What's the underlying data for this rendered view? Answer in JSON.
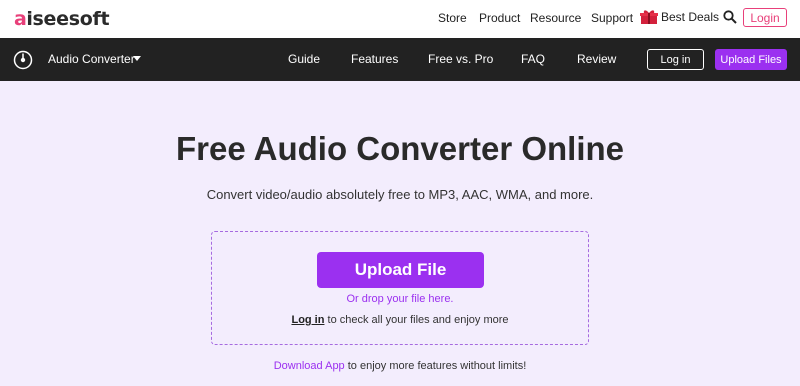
{
  "brand": {
    "logo_mark": "a",
    "logo_text": "iseesoft"
  },
  "top_nav": {
    "items": [
      "Store",
      "Product",
      "Resource",
      "Support"
    ],
    "deals_label": "Best Deals",
    "login_label": "Login"
  },
  "navbar": {
    "app_title": "Audio Converter",
    "links": [
      "Guide",
      "Features",
      "Free vs. Pro",
      "FAQ",
      "Review"
    ],
    "login_label": "Log in",
    "upload_label": "Upload Files"
  },
  "hero": {
    "title": "Free Audio Converter Online",
    "subtitle": "Convert video/audio absolutely free to MP3, AAC, WMA, and more."
  },
  "upload": {
    "button_label": "Upload File",
    "drop_hint": "Or drop your file here.",
    "login_link": "Log in",
    "login_suffix": " to check all your files and enjoy more"
  },
  "footer": {
    "download_link": "Download App",
    "download_suffix": " to enjoy more features without limits!"
  },
  "colors": {
    "accent": "#9b30f0",
    "brand_pink": "#e8407a",
    "navbar_bg": "#222222",
    "page_bg": "#f3edfd"
  },
  "icons": [
    "gift-icon",
    "search-icon",
    "audio-converter-icon",
    "caret-down-icon"
  ]
}
